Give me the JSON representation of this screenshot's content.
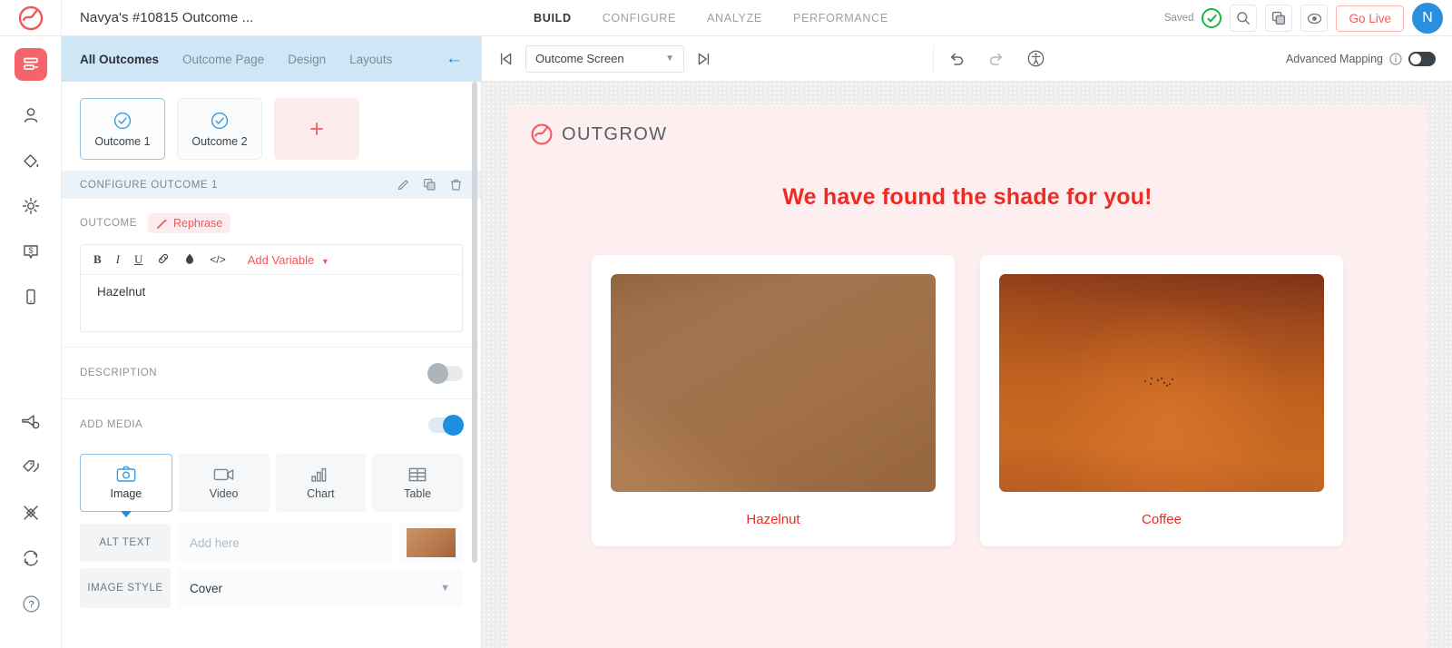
{
  "topbar": {
    "logo_icon": "outgrow-logo-icon",
    "project_title": "Navya's #10815 Outcome ...",
    "nav": [
      {
        "label": "BUILD",
        "active": true
      },
      {
        "label": "CONFIGURE",
        "active": false
      },
      {
        "label": "ANALYZE",
        "active": false
      },
      {
        "label": "PERFORMANCE",
        "active": false
      }
    ],
    "saved_label": "Saved",
    "saved_icon": "check-circle-icon",
    "actions": [
      {
        "icon": "search-icon"
      },
      {
        "icon": "copy-icon"
      },
      {
        "icon": "preview-eye-icon"
      }
    ],
    "go_live_label": "Go Live",
    "avatar_initial": "N",
    "avatar_color": "#2a8fdd",
    "accent_color": "#f2595b",
    "saved_color": "#19b845"
  },
  "rail": {
    "items": [
      {
        "icon": "content-blocks-icon",
        "active": true
      },
      {
        "icon": "user-icon",
        "active": false
      },
      {
        "icon": "paint-bucket-icon",
        "active": false
      },
      {
        "icon": "gear-icon",
        "active": false
      },
      {
        "icon": "dollar-chat-icon",
        "active": false
      },
      {
        "icon": "mobile-device-icon",
        "active": false
      },
      {
        "icon": "megaphone-settings-icon",
        "active": false
      },
      {
        "icon": "tags-icon",
        "active": false
      },
      {
        "icon": "integrations-icon",
        "active": false
      },
      {
        "icon": "sync-icon",
        "active": false
      },
      {
        "icon": "help-icon",
        "active": false
      }
    ]
  },
  "panel": {
    "tabs": [
      {
        "label": "All Outcomes",
        "active": true
      },
      {
        "label": "Outcome Page",
        "active": false
      },
      {
        "label": "Design",
        "active": false
      },
      {
        "label": "Layouts",
        "active": false
      }
    ],
    "collapse_icon": "arrow-left-icon",
    "outcomes": [
      {
        "label": "Outcome 1",
        "selected": true,
        "icon": "check-circle-outline-icon"
      },
      {
        "label": "Outcome 2",
        "selected": false,
        "icon": "check-circle-outline-icon"
      }
    ],
    "add_outcome_label": "+",
    "configure_header": "CONFIGURE OUTCOME 1",
    "configure_actions": [
      {
        "icon": "pencil-icon"
      },
      {
        "icon": "duplicate-icon"
      },
      {
        "icon": "trash-icon"
      }
    ],
    "outcome_section": {
      "label": "OUTCOME",
      "rephrase_label": "Rephrase",
      "rephrase_icon": "magic-wand-icon",
      "toolbar": [
        {
          "icon": "bold-icon",
          "glyph": "B"
        },
        {
          "icon": "italic-icon",
          "glyph": "I"
        },
        {
          "icon": "underline-icon",
          "glyph": "U"
        },
        {
          "icon": "link-icon",
          "glyph": "%"
        },
        {
          "icon": "text-color-icon",
          "glyph": "●"
        },
        {
          "icon": "code-icon",
          "glyph": "</>"
        }
      ],
      "add_variable_label": "Add Variable",
      "add_variable_icon": "chevron-down-icon",
      "value": "Hazelnut"
    },
    "description_section": {
      "label": "DESCRIPTION",
      "toggle_on": false
    },
    "media_section": {
      "label": "ADD MEDIA",
      "toggle_on": true,
      "tabs": [
        {
          "label": "Image",
          "icon": "camera-icon",
          "selected": true
        },
        {
          "label": "Video",
          "icon": "video-camera-icon",
          "selected": false
        },
        {
          "label": "Chart",
          "icon": "bar-chart-icon",
          "selected": false
        },
        {
          "label": "Table",
          "icon": "table-grid-icon",
          "selected": false
        }
      ],
      "alt_text_label": "ALT TEXT",
      "alt_text_placeholder": "Add here",
      "alt_text_value": "",
      "thumbnail_icon": "image-thumbnail",
      "image_style_label": "IMAGE STYLE",
      "image_style_value": "Cover",
      "image_style_chevron": "chevron-down-icon"
    }
  },
  "canvas_toolbar": {
    "first_screen_icon": "skip-to-first-icon",
    "screen_select_value": "Outcome Screen",
    "screen_select_chevron": "chevron-down-icon",
    "next_screen_icon": "skip-to-next-icon",
    "undo_icon": "undo-icon",
    "redo_icon": "redo-icon",
    "accessibility_icon": "accessibility-icon",
    "advanced_mapping_label": "Advanced Mapping",
    "advanced_mapping_info_icon": "info-icon",
    "advanced_mapping_on": true
  },
  "preview": {
    "logo_icon": "outgrow-logo-icon",
    "wordmark": "OUTGROW",
    "heading": "We have found the shade for you!",
    "heading_color": "#ee2a24",
    "background_color": "#fdeef0",
    "cards": [
      {
        "caption": "Hazelnut",
        "image": "hazelnut-sand-photo"
      },
      {
        "caption": "Coffee",
        "image": "coffee-orange-sky-photo"
      }
    ]
  }
}
